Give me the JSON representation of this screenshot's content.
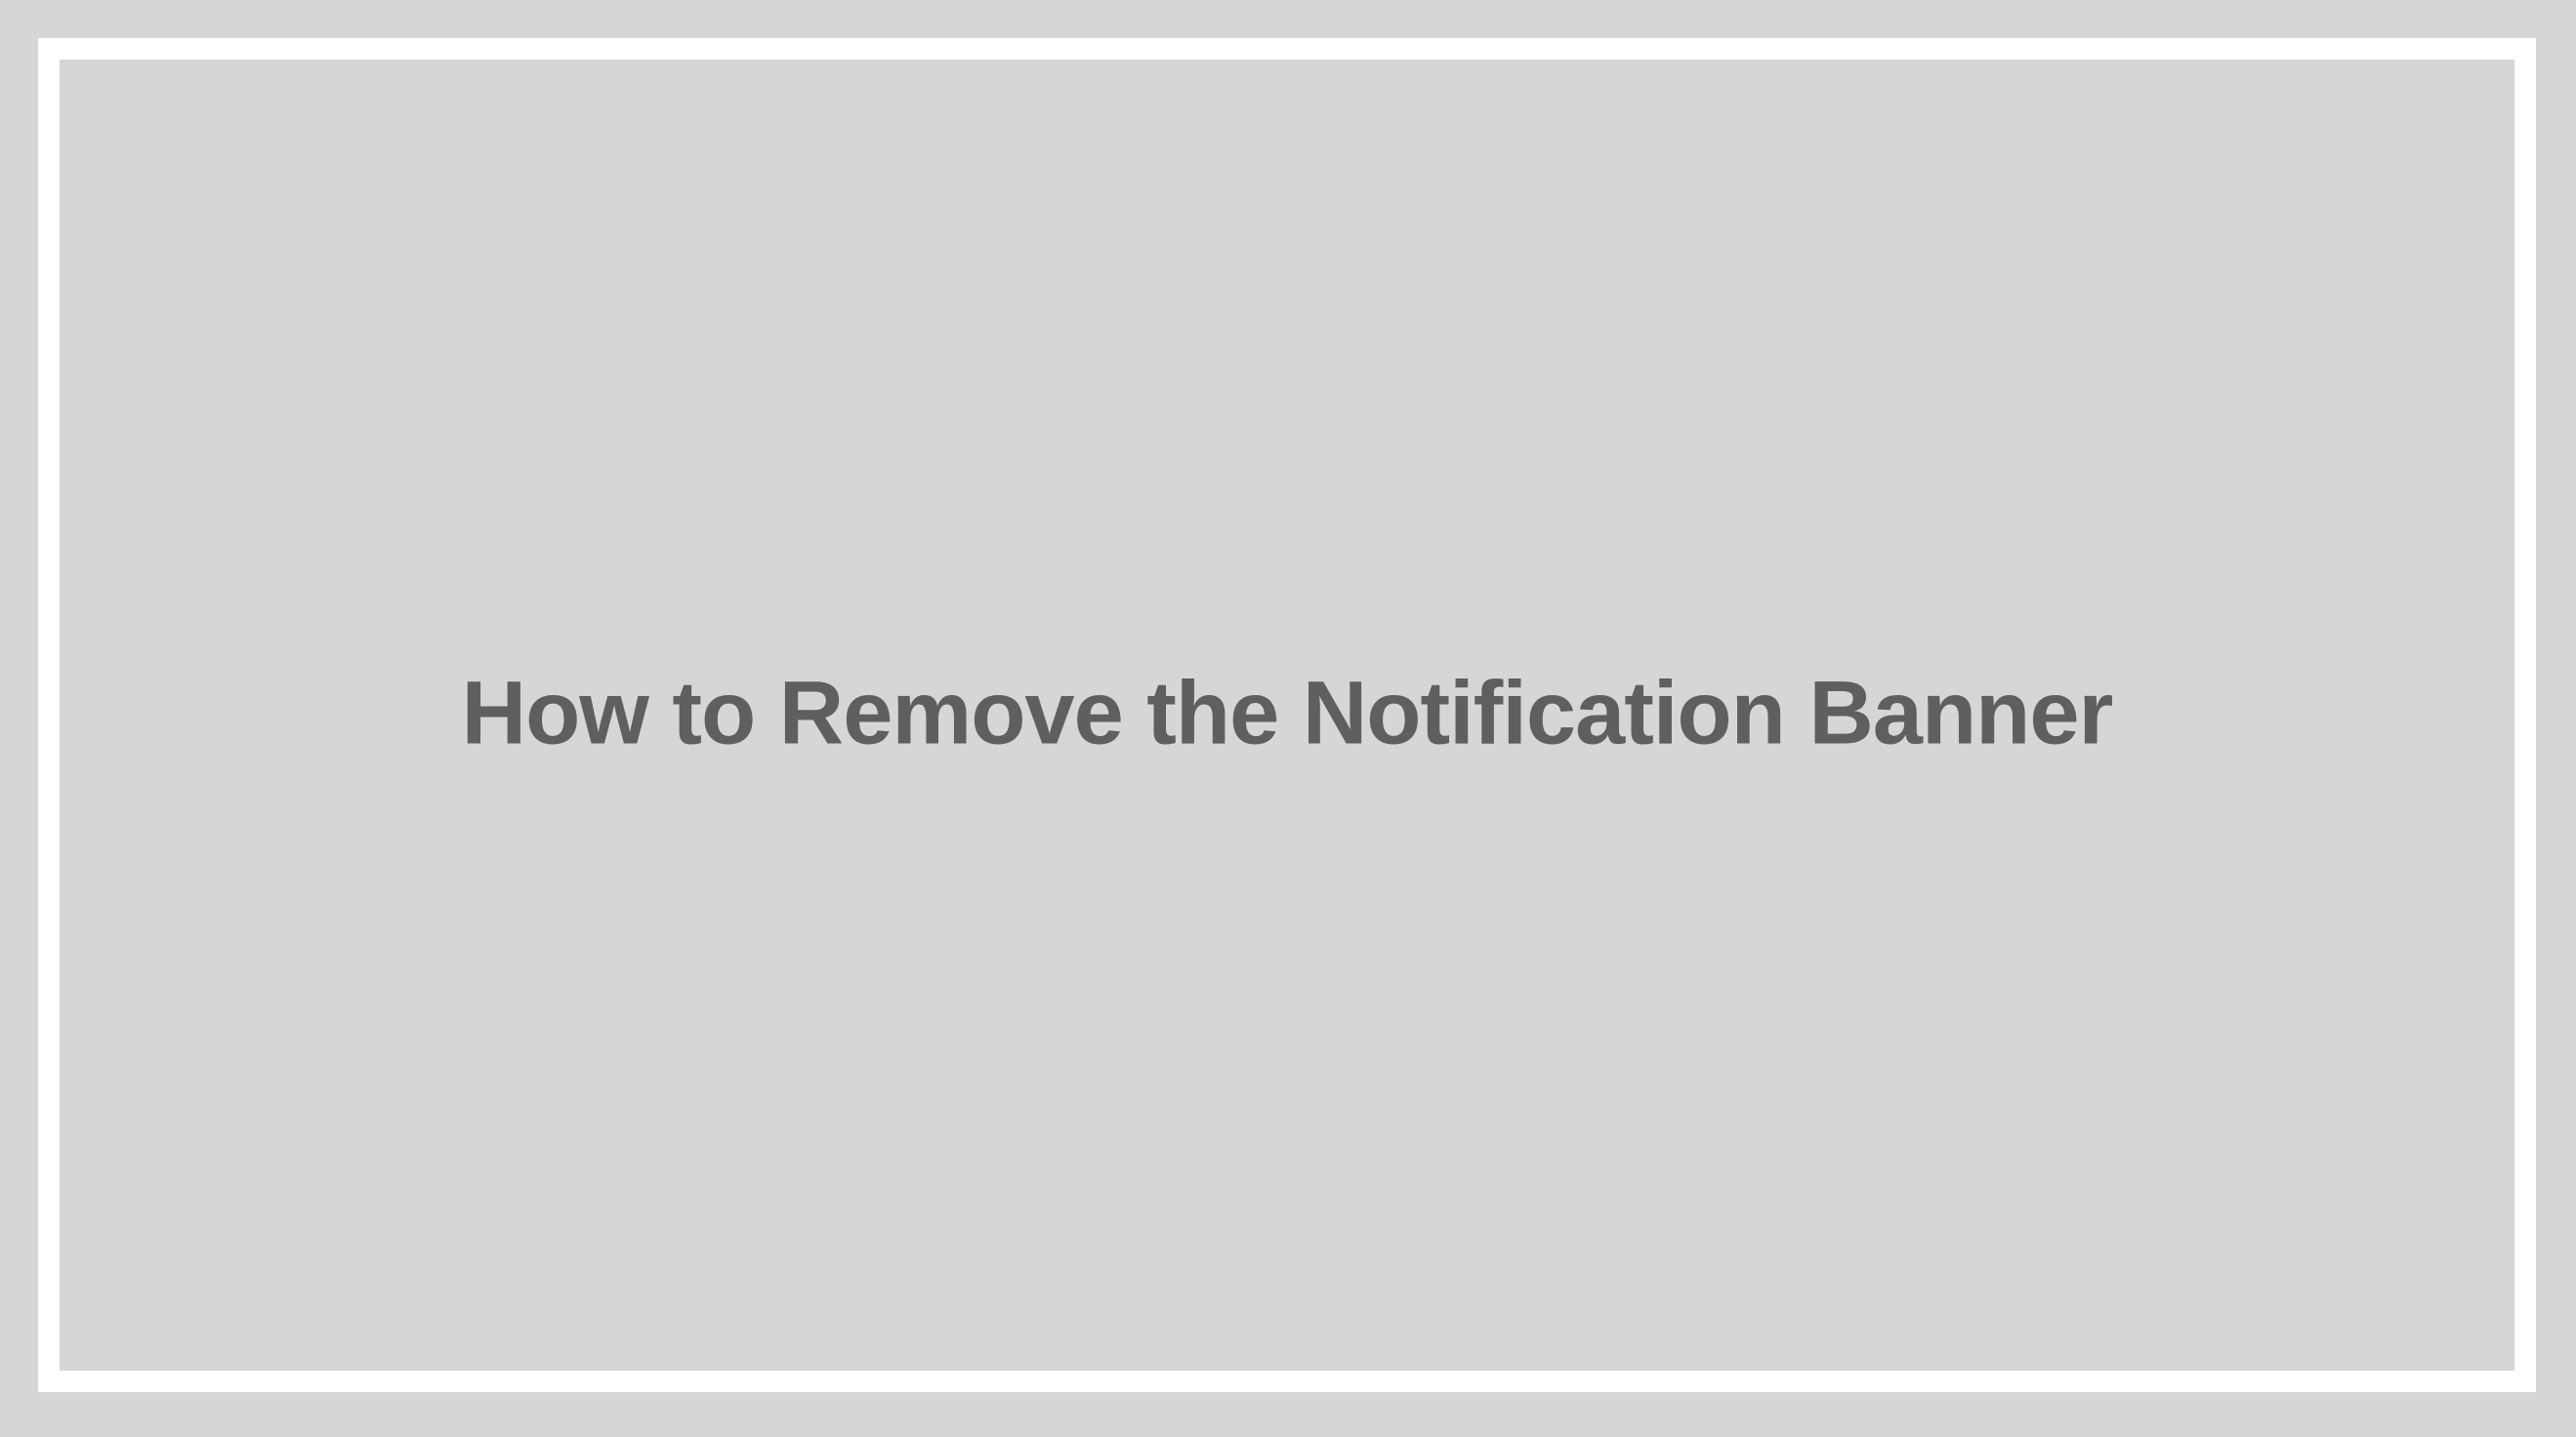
{
  "slide": {
    "title": "How to Remove the Notification Banner"
  },
  "colors": {
    "background": "#d6d6d6",
    "frame_border": "#ffffff",
    "title_text": "#5f5f5f"
  }
}
